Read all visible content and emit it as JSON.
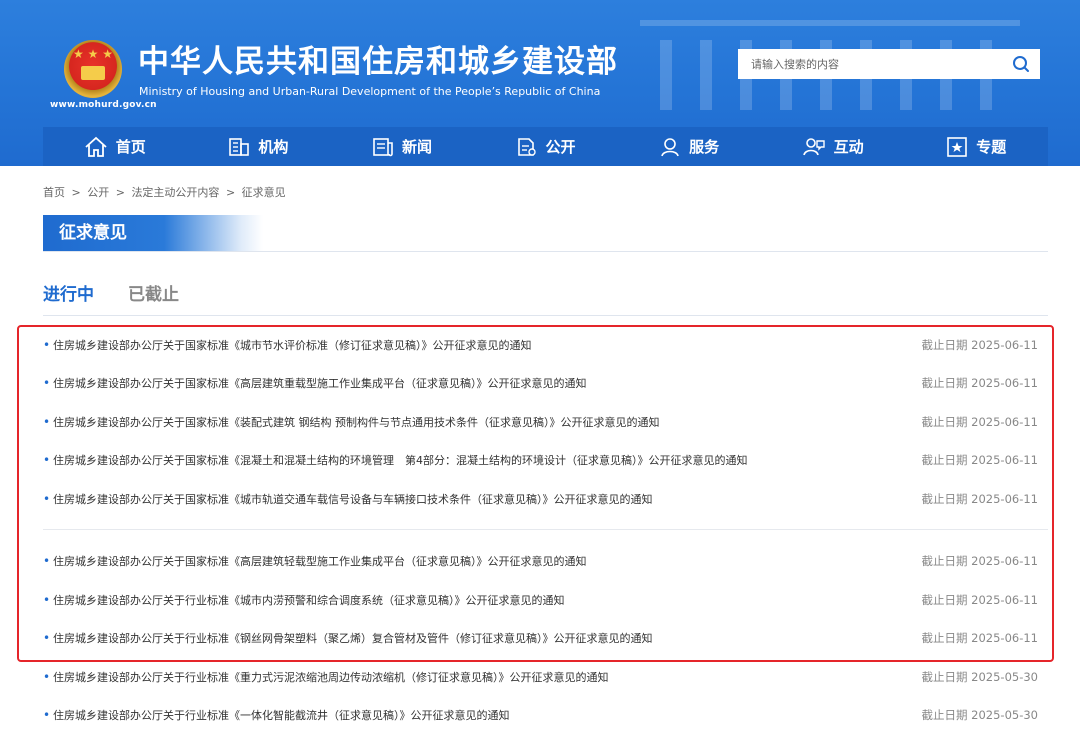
{
  "header": {
    "title": "中华人民共和国住房和城乡建设部",
    "subtitle": "Ministry of Housing and Urban-Rural Development of the People’s Republic of China",
    "url": "www.mohurd.gov.cn",
    "search_placeholder": "请输入搜索的内容"
  },
  "nav": {
    "items": [
      {
        "label": "首页",
        "icon": "home-icon"
      },
      {
        "label": "机构",
        "icon": "building-icon"
      },
      {
        "label": "新闻",
        "icon": "news-icon"
      },
      {
        "label": "公开",
        "icon": "document-icon"
      },
      {
        "label": "服务",
        "icon": "service-icon"
      },
      {
        "label": "互动",
        "icon": "interaction-icon"
      },
      {
        "label": "专题",
        "icon": "star-icon"
      }
    ]
  },
  "breadcrumb": {
    "items": [
      "首页",
      "公开",
      "法定主动公开内容",
      "征求意见"
    ],
    "separator": ">"
  },
  "section": {
    "title": "征求意见"
  },
  "tabs": {
    "active": "进行中",
    "inactive": "已截止"
  },
  "list": {
    "items": [
      {
        "title": "住房城乡建设部办公厅关于国家标准《城市节水评价标准（修订征求意见稿）》公开征求意见的通知",
        "date": "截止日期 2025-06-11"
      },
      {
        "title": "住房城乡建设部办公厅关于国家标准《高层建筑重载型施工作业集成平台（征求意见稿）》公开征求意见的通知",
        "date": "截止日期 2025-06-11"
      },
      {
        "title": "住房城乡建设部办公厅关于国家标准《装配式建筑 钢结构 预制构件与节点通用技术条件（征求意见稿）》公开征求意见的通知",
        "date": "截止日期 2025-06-11"
      },
      {
        "title": "住房城乡建设部办公厅关于国家标准《混凝土和混凝土结构的环境管理　第4部分：混凝土结构的环境设计（征求意见稿）》公开征求意见的通知",
        "date": "截止日期 2025-06-11"
      },
      {
        "title": "住房城乡建设部办公厅关于国家标准《城市轨道交通车载信号设备与车辆接口技术条件（征求意见稿）》公开征求意见的通知",
        "date": "截止日期 2025-06-11"
      },
      {
        "title": "住房城乡建设部办公厅关于国家标准《高层建筑轻载型施工作业集成平台（征求意见稿）》公开征求意见的通知",
        "date": "截止日期 2025-06-11"
      },
      {
        "title": "住房城乡建设部办公厅关于行业标准《城市内涝预警和综合调度系统（征求意见稿）》公开征求意见的通知",
        "date": "截止日期 2025-06-11"
      },
      {
        "title": "住房城乡建设部办公厅关于行业标准《钢丝网骨架塑料（聚乙烯）复合管材及管件（修订征求意见稿）》公开征求意见的通知",
        "date": "截止日期 2025-06-11"
      },
      {
        "title": "住房城乡建设部办公厅关于行业标准《重力式污泥浓缩池周边传动浓缩机（修订征求意见稿）》公开征求意见的通知",
        "date": "截止日期 2025-05-30"
      },
      {
        "title": "住房城乡建设部办公厅关于行业标准《一体化智能截流井（征求意见稿）》公开征求意见的通知",
        "date": "截止日期 2025-05-30"
      }
    ]
  },
  "colors": {
    "brand_blue": "#1f6bcf",
    "nav_blue": "#1b63c4",
    "highlight_red": "#e5252a"
  }
}
